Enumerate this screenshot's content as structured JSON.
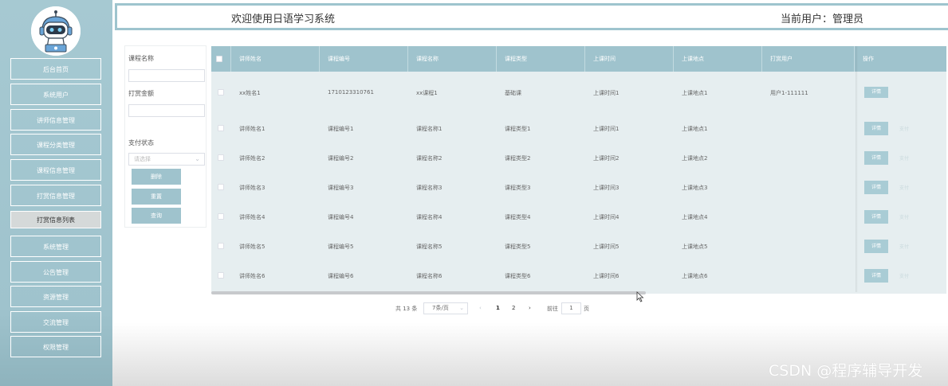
{
  "app": {
    "welcome": "欢迎使用日语学习系统",
    "current_user": "当前用户：管理员"
  },
  "sidebar": {
    "items": [
      {
        "label": "后台首页"
      },
      {
        "label": "系统用户"
      },
      {
        "label": "讲师信息管理"
      },
      {
        "label": "课程分类管理"
      },
      {
        "label": "课程信息管理"
      },
      {
        "label": "打赏信息管理"
      },
      {
        "label": "打赏信息列表",
        "active": true
      },
      {
        "label": "系统管理"
      },
      {
        "label": "公告管理"
      },
      {
        "label": "资源管理"
      },
      {
        "label": "交流管理"
      },
      {
        "label": "权限管理"
      }
    ]
  },
  "search": {
    "course_name_label": "课程名称",
    "amount_label": "打赏金额",
    "pay_status_label": "支付状态",
    "pay_status_placeholder": "请选择",
    "delete_label": "删除",
    "reset_label": "重置",
    "query_label": "查询"
  },
  "table": {
    "headers": [
      "讲师姓名",
      "课程编号",
      "课程名称",
      "课程类型",
      "上课时间",
      "上课地点",
      "打赏用户",
      "操作"
    ],
    "rows": [
      {
        "teacher": "xx姓名1",
        "code": "1710123310761",
        "name": "xx课程1",
        "type": "基础课",
        "time": "上课时间1",
        "place": "上课地点1",
        "user": "用户1-111111",
        "detail": "详情",
        "pay": ""
      },
      {
        "teacher": "讲师姓名1",
        "code": "课程编号1",
        "name": "课程名称1",
        "type": "课程类型1",
        "time": "上课时间1",
        "place": "上课地点1",
        "user": "",
        "detail": "详情",
        "pay": "支付"
      },
      {
        "teacher": "讲师姓名2",
        "code": "课程编号2",
        "name": "课程名称2",
        "type": "课程类型2",
        "time": "上课时间2",
        "place": "上课地点2",
        "user": "",
        "detail": "详情",
        "pay": "支付"
      },
      {
        "teacher": "讲师姓名3",
        "code": "课程编号3",
        "name": "课程名称3",
        "type": "课程类型3",
        "time": "上课时间3",
        "place": "上课地点3",
        "user": "",
        "detail": "详情",
        "pay": "支付"
      },
      {
        "teacher": "讲师姓名4",
        "code": "课程编号4",
        "name": "课程名称4",
        "type": "课程类型4",
        "time": "上课时间4",
        "place": "上课地点4",
        "user": "",
        "detail": "详情",
        "pay": "支付"
      },
      {
        "teacher": "讲师姓名5",
        "code": "课程编号5",
        "name": "课程名称5",
        "type": "课程类型5",
        "time": "上课时间5",
        "place": "上课地点5",
        "user": "",
        "detail": "详情",
        "pay": "支付"
      },
      {
        "teacher": "讲师姓名6",
        "code": "课程编号6",
        "name": "课程名称6",
        "type": "课程类型6",
        "time": "上课时间6",
        "place": "上课地点6",
        "user": "",
        "detail": "详情",
        "pay": "支付"
      }
    ]
  },
  "pagination": {
    "total": "共 13 条",
    "page_size": "7条/页",
    "prev": "‹",
    "page1": "1",
    "page2": "2",
    "next": "›",
    "goto": "前往",
    "page_input": "1",
    "page_unit": "页"
  },
  "watermark": "CSDN @程序辅导开发",
  "icons": {
    "logo": "robot-avatar-icon",
    "select": "chevron-down-icon",
    "cursor": "mouse-pointer-icon"
  },
  "colors": {
    "accent": "#9fc3cd",
    "sidebar": "#a6c9d2",
    "table_bg": "#e6eef0"
  }
}
